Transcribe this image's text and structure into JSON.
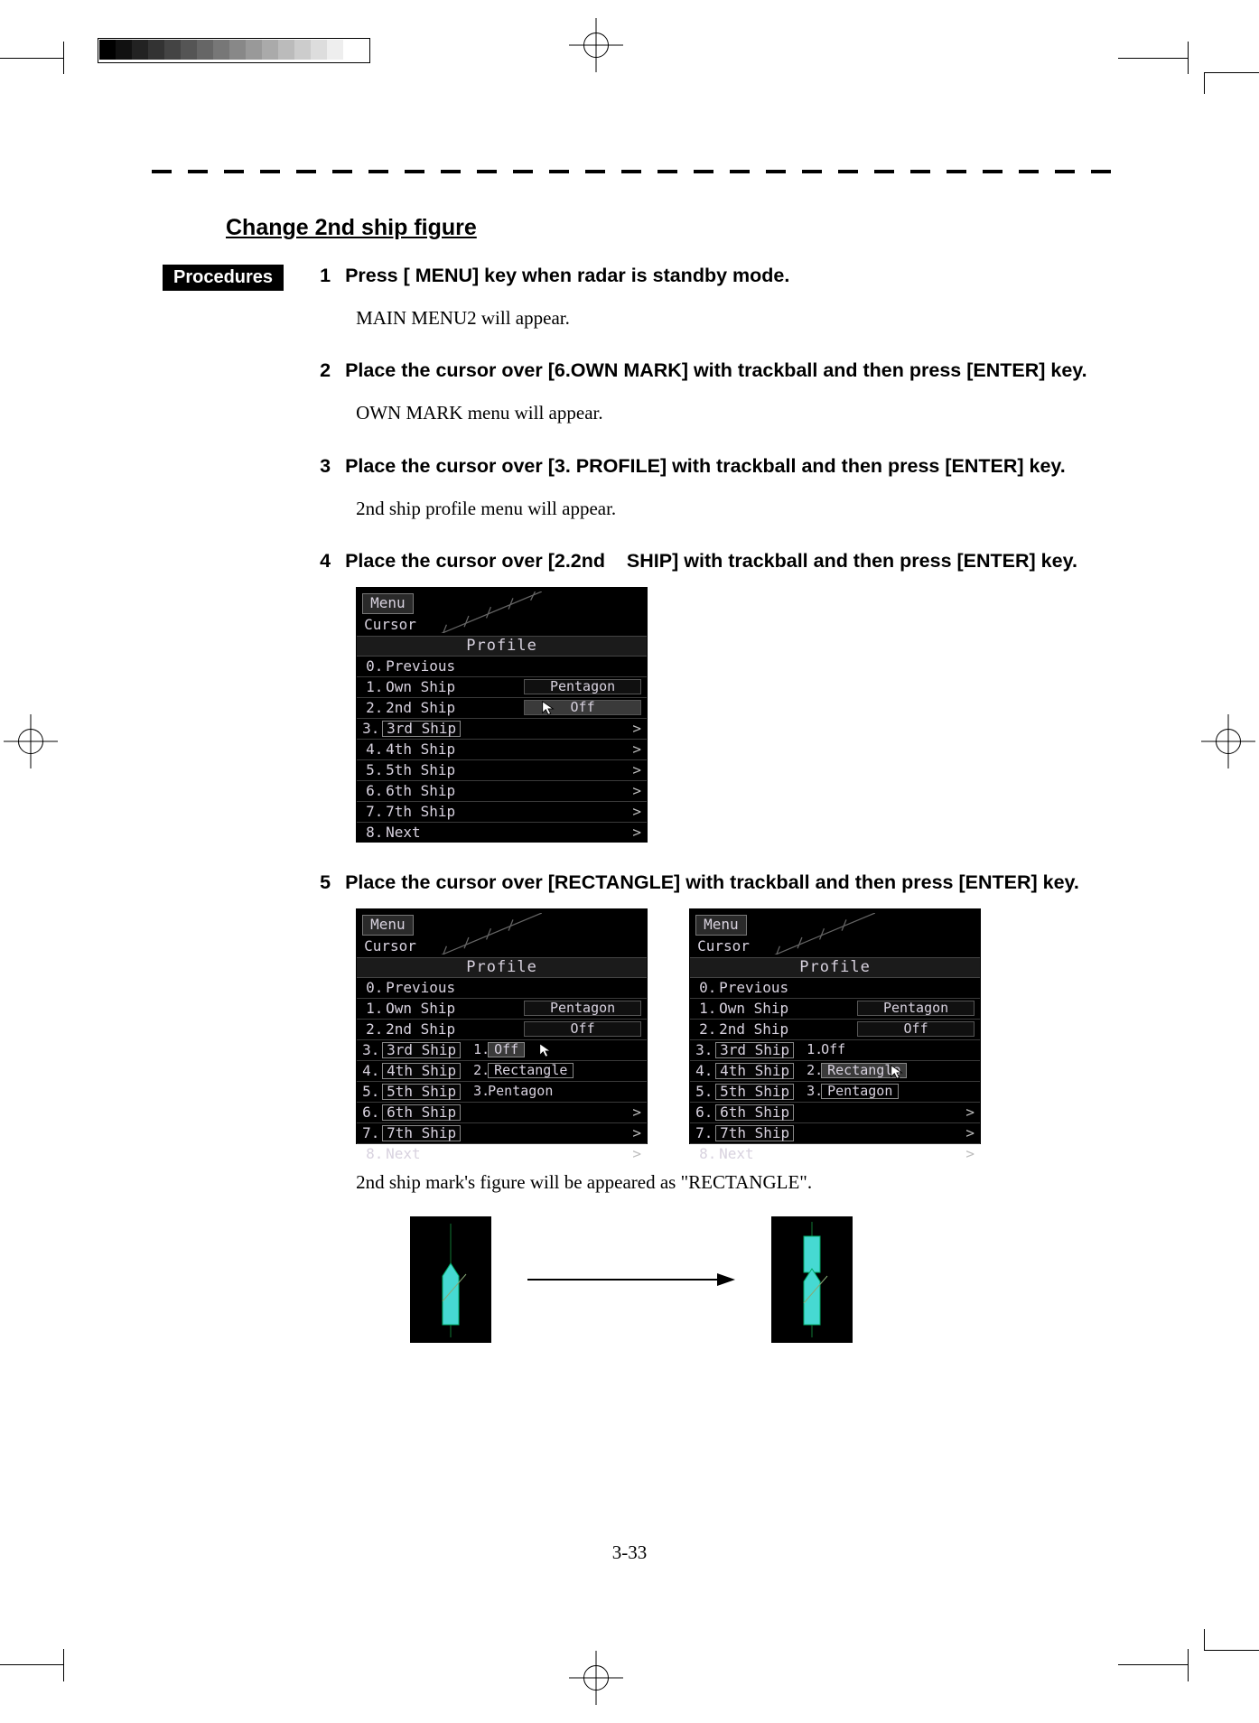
{
  "section_title": "Change 2nd ship figure",
  "procedures_label": "Procedures",
  "page_number": "3-33",
  "steps": {
    "1": {
      "num": "1",
      "title": "Press [ MENU] key when radar is standby mode.",
      "body": "MAIN MENU2 will appear."
    },
    "2": {
      "num": "2",
      "title": "Place the cursor over [6.OWN MARK] with trackball and then press [ENTER] key.",
      "body": "OWN MARK menu will appear."
    },
    "3": {
      "num": "3",
      "title": "Place the cursor over [3. PROFILE] with trackball and then press [ENTER] key.",
      "body": "2nd ship profile menu will appear."
    },
    "4": {
      "num": "4",
      "title": "Place the cursor over [2.2nd    SHIP] with trackball and then press [ENTER] key."
    },
    "5": {
      "num": "5",
      "title": "Place the cursor over [RECTANGLE] with trackball and then press [ENTER] key.",
      "body": "2nd ship mark's figure will be appeared as \"RECTANGLE\"."
    }
  },
  "menu_common": {
    "menu_btn": "Menu",
    "cursor_label": "Cursor",
    "title": "Profile",
    "rows": {
      "r0": {
        "num": "0.",
        "lbl": "Previous"
      },
      "r1": {
        "num": "1.",
        "lbl": "Own  Ship",
        "val": "Pentagon"
      },
      "r2": {
        "num": "2.",
        "lbl": "2nd  Ship",
        "val": "Off"
      },
      "r3": {
        "num": "3.",
        "lbl": "3rd  Ship"
      },
      "r4": {
        "num": "4.",
        "lbl": "4th  Ship"
      },
      "r5": {
        "num": "5.",
        "lbl": "5th  Ship"
      },
      "r6": {
        "num": "6.",
        "lbl": "6th  Ship"
      },
      "r7": {
        "num": "7.",
        "lbl": "7th  Ship"
      },
      "r8": {
        "num": "8.",
        "lbl": "Next"
      }
    },
    "arrow": ">",
    "submenu": {
      "s1": {
        "num": "1.",
        "lbl": "Off"
      },
      "s2": {
        "num": "2.",
        "lbl": "Rectangle"
      },
      "s3": {
        "num": "3.",
        "lbl": "Pentagon"
      }
    }
  }
}
